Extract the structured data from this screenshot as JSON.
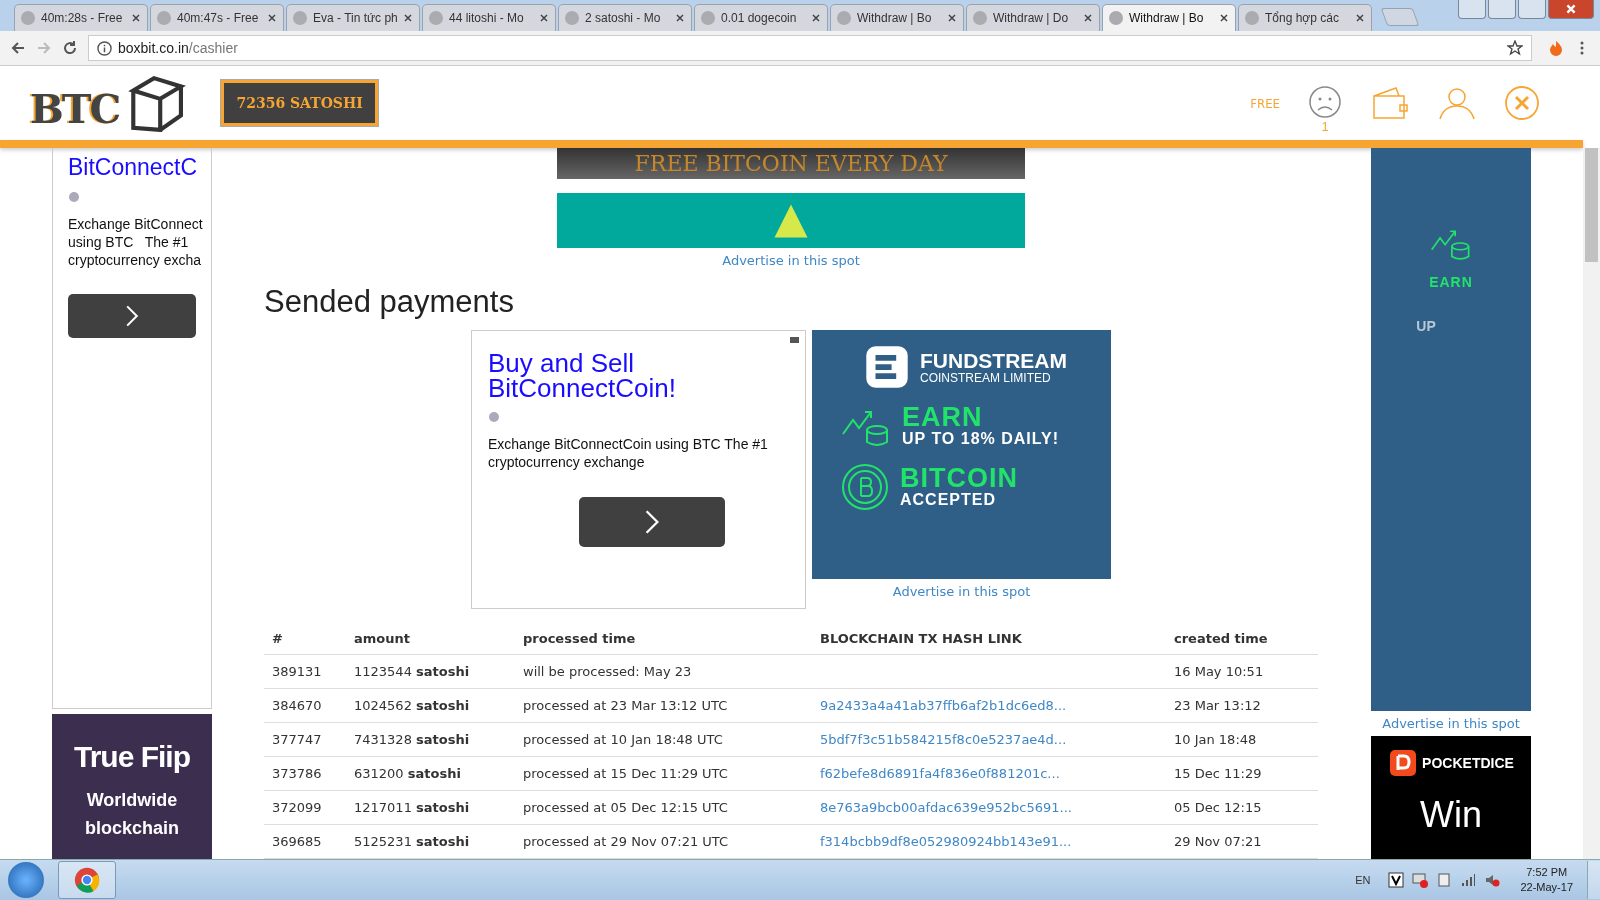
{
  "browser": {
    "tabs": [
      {
        "title": "40m:28s - Free",
        "selected": false
      },
      {
        "title": "40m:47s - Free",
        "selected": false
      },
      {
        "title": "Eva - Tin tức ph",
        "selected": false
      },
      {
        "title": "44 litoshi - Mo",
        "selected": false
      },
      {
        "title": "2 satoshi - Mo",
        "selected": false
      },
      {
        "title": "0.01 dogecoin",
        "selected": false
      },
      {
        "title": "Withdraw | Bo",
        "selected": false
      },
      {
        "title": "Withdraw | Do",
        "selected": false
      },
      {
        "title": "Withdraw | Bo",
        "selected": true
      },
      {
        "title": "Tổng hợp các",
        "selected": false
      }
    ],
    "url_host": "boxbit.co.in",
    "url_path": "/cashier"
  },
  "header": {
    "logo": "BTC",
    "balance": "72356 SATOSHI",
    "free_label": "FREE",
    "mood_count": "1"
  },
  "left_ad": {
    "title": "BitConnectC",
    "body": "Exchange BitConnect using BTC   The #1 cryptocurrency excha"
  },
  "left_ad_2": {
    "title": "True Fiip",
    "lines": [
      "Worldwide",
      "blockchain"
    ]
  },
  "banner": {
    "text": "FREE BITCOIN EVERY DAY",
    "link": "Advertise in this spot"
  },
  "heading": "Sended payments",
  "ad": {
    "title": "Buy and Sell BitConnectCoin!",
    "body": "Exchange BitConnectCoin using BTC The #1 cryptocurrency exchange"
  },
  "fundstream_ad": {
    "brand": "FUNDSTREAM",
    "sub": "COINSTREAM LIMITED",
    "earn": "EARN",
    "earn_sub": "UP TO 18% DAILY!",
    "bitcoin": "BITCOIN",
    "bitcoin_sub": "ACCEPTED",
    "link": "Advertise in this spot"
  },
  "right_ad": {
    "earn": "EARN",
    "up": "UP",
    "link": "Advertise in this spot"
  },
  "right_ad_2": {
    "brand": "POCKETDICE",
    "text": "Win"
  },
  "table": {
    "columns": [
      "#",
      "amount",
      "processed time",
      "BLOCKCHAIN TX HASH LINK",
      "created time"
    ],
    "rows": [
      {
        "id": "389131",
        "amount": "1123544",
        "unit": "satoshi",
        "processed": "will be processed: May 23",
        "created": "16 May 10:51"
      },
      {
        "id": "384670",
        "amount": "1024562",
        "unit": "satoshi",
        "processed": "processed at 23 Mar 13:12 UTC",
        "hash": "9a2433a4a41ab37ffb6af2b1dc6ed8...",
        "created": "23 Mar 13:12"
      },
      {
        "id": "377747",
        "amount": "7431328",
        "unit": "satoshi",
        "processed": "processed at 10 Jan 18:48 UTC",
        "hash": "5bdf7f3c51b584215f8c0e5237ae4d...",
        "created": "10 Jan 18:48"
      },
      {
        "id": "373786",
        "amount": "631200",
        "unit": "satoshi",
        "processed": "processed at 15 Dec 11:29 UTC",
        "hash": "f62befe8d6891fa4f836e0f881201c...",
        "created": "15 Dec 11:29"
      },
      {
        "id": "372099",
        "amount": "1217011",
        "unit": "satoshi",
        "processed": "processed at 05 Dec 12:15 UTC",
        "hash": "8e763a9bcb00afdac639e952bc5691...",
        "created": "05 Dec 12:15"
      },
      {
        "id": "369685",
        "amount": "5125231",
        "unit": "satoshi",
        "processed": "processed at 29 Nov 07:21 UTC",
        "hash": "f314bcbb9df8e052980924bb143e91...",
        "created": "29 Nov 07:21"
      }
    ]
  },
  "taskbar": {
    "language": "EN",
    "time": "7:52 PM",
    "date": "22-May-17"
  }
}
